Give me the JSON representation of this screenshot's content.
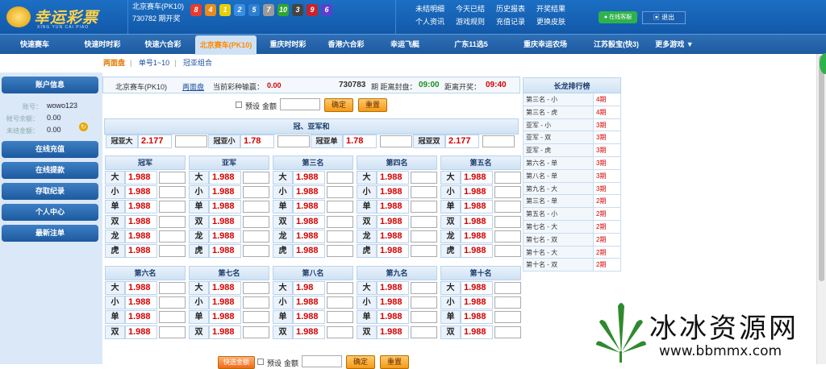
{
  "brand": {
    "name": "幸运彩票",
    "pinyin": "XING YUN CAI PIAO"
  },
  "draw": {
    "game": "北京赛车(PK10)",
    "period": "730782 期开奖"
  },
  "balls": [
    {
      "n": "8",
      "c": "#e63b2e"
    },
    {
      "n": "4",
      "c": "#e98b1d"
    },
    {
      "n": "1",
      "c": "#e8cf00"
    },
    {
      "n": "2",
      "c": "#3a8de0"
    },
    {
      "n": "5",
      "c": "#2d7fd0"
    },
    {
      "n": "7",
      "c": "#9a9a9a"
    },
    {
      "n": "10",
      "c": "#2fa52f"
    },
    {
      "n": "3",
      "c": "#444444"
    },
    {
      "n": "9",
      "c": "#c8232c"
    },
    {
      "n": "6",
      "c": "#5a3fd0"
    }
  ],
  "toplinks": [
    "未结明细",
    "今天已结",
    "历史报表",
    "开奖结果",
    "个人资讯",
    "游戏规则",
    "充值记录",
    "更换皮肤"
  ],
  "online_service": "在线客服",
  "logout": "退出",
  "nav": [
    "快速赛车",
    "快速时时彩",
    "快速六合彩",
    "北京赛车(PK10)",
    "重庆时时彩",
    "香港六合彩",
    "幸运飞艇",
    "广东11选5",
    "重庆幸运农场",
    "江苏骰宝(快3)",
    "更多游戏 ▼"
  ],
  "subnav": [
    "两面盘",
    "单号1~10",
    "冠亚组合"
  ],
  "account": {
    "title": "账户信息",
    "id_label": "账号：",
    "id": "wowo123",
    "bal_label": "帐号余额：",
    "bal": "0.00",
    "unset_label": "未结金额：",
    "unset": "0.00"
  },
  "side_menu": [
    "在线充值",
    "在线提款",
    "存取纪录",
    "个人中心",
    "最新注单"
  ],
  "info": {
    "game": "北京赛车(PK10)",
    "mode": "两面盘",
    "win_label": "当前彩种输赢：",
    "win": "0.00",
    "period": "730783",
    "seal_label": "期 距离封盘：",
    "seal": "09:00",
    "open_label": "距离开奖：",
    "open": "09:40"
  },
  "preset": {
    "preset": "预设",
    "amount": "金额",
    "confirm": "确定",
    "reset": "重置"
  },
  "gy": {
    "title": "冠、亚军和",
    "items": [
      {
        "l": "冠亚大",
        "o": "2.177"
      },
      {
        "l": "冠亚小",
        "o": "1.78"
      },
      {
        "l": "冠亚单",
        "o": "1.78"
      },
      {
        "l": "冠亚双",
        "o": "2.177"
      }
    ]
  },
  "grid1": [
    {
      "t": "冠军",
      "r": [
        [
          "大",
          "1.988"
        ],
        [
          "小",
          "1.988"
        ],
        [
          "单",
          "1.988"
        ],
        [
          "双",
          "1.988"
        ],
        [
          "龙",
          "1.988"
        ],
        [
          "虎",
          "1.988"
        ]
      ]
    },
    {
      "t": "亚军",
      "r": [
        [
          "大",
          "1.988"
        ],
        [
          "小",
          "1.988"
        ],
        [
          "单",
          "1.988"
        ],
        [
          "双",
          "1.988"
        ],
        [
          "龙",
          "1.988"
        ],
        [
          "虎",
          "1.988"
        ]
      ]
    },
    {
      "t": "第三名",
      "r": [
        [
          "大",
          "1.988"
        ],
        [
          "小",
          "1.988"
        ],
        [
          "单",
          "1.988"
        ],
        [
          "双",
          "1.988"
        ],
        [
          "龙",
          "1.988"
        ],
        [
          "虎",
          "1.988"
        ]
      ]
    },
    {
      "t": "第四名",
      "r": [
        [
          "大",
          "1.988"
        ],
        [
          "小",
          "1.988"
        ],
        [
          "单",
          "1.988"
        ],
        [
          "双",
          "1.988"
        ],
        [
          "龙",
          "1.988"
        ],
        [
          "虎",
          "1.988"
        ]
      ]
    },
    {
      "t": "第五名",
      "r": [
        [
          "大",
          "1.988"
        ],
        [
          "小",
          "1.988"
        ],
        [
          "单",
          "1.988"
        ],
        [
          "双",
          "1.988"
        ],
        [
          "龙",
          "1.988"
        ],
        [
          "虎",
          "1.988"
        ]
      ]
    }
  ],
  "grid2": [
    {
      "t": "第六名",
      "r": [
        [
          "大",
          "1.988"
        ],
        [
          "小",
          "1.988"
        ],
        [
          "单",
          "1.988"
        ],
        [
          "双",
          "1.988"
        ]
      ]
    },
    {
      "t": "第七名",
      "r": [
        [
          "大",
          "1.988"
        ],
        [
          "小",
          "1.988"
        ],
        [
          "单",
          "1.988"
        ],
        [
          "双",
          "1.988"
        ]
      ]
    },
    {
      "t": "第八名",
      "r": [
        [
          "大",
          "1.98"
        ],
        [
          "小",
          "1.988"
        ],
        [
          "单",
          "1.988"
        ],
        [
          "双",
          "1.988"
        ]
      ]
    },
    {
      "t": "第九名",
      "r": [
        [
          "大",
          "1.988"
        ],
        [
          "小",
          "1.988"
        ],
        [
          "单",
          "1.988"
        ],
        [
          "双",
          "1.988"
        ]
      ]
    },
    {
      "t": "第十名",
      "r": [
        [
          "大",
          "1.988"
        ],
        [
          "小",
          "1.988"
        ],
        [
          "单",
          "1.988"
        ],
        [
          "双",
          "1.988"
        ]
      ]
    }
  ],
  "bottom": {
    "quick": "快选金额",
    "preset": "预设",
    "amount": "金额",
    "confirm": "确定",
    "reset": "重置"
  },
  "rank": {
    "title": "长龙排行榜",
    "rows": [
      [
        "第三名 - 小",
        "4期"
      ],
      [
        "第三名 - 虎",
        "4期"
      ],
      [
        "亚军 - 小",
        "3期"
      ],
      [
        "亚军 - 双",
        "3期"
      ],
      [
        "亚军 - 虎",
        "3期"
      ],
      [
        "第六名 - 单",
        "3期"
      ],
      [
        "第八名 - 单",
        "3期"
      ],
      [
        "第九名 - 大",
        "3期"
      ],
      [
        "第三名 - 单",
        "2期"
      ],
      [
        "第五名 - 小",
        "2期"
      ],
      [
        "第七名 - 大",
        "2期"
      ],
      [
        "第七名 - 双",
        "2期"
      ],
      [
        "第十名 - 大",
        "2期"
      ],
      [
        "第十名 - 双",
        "2期"
      ]
    ]
  },
  "watermark": {
    "cn": "冰冰资源网",
    "url": "www.bbmmx.com"
  }
}
